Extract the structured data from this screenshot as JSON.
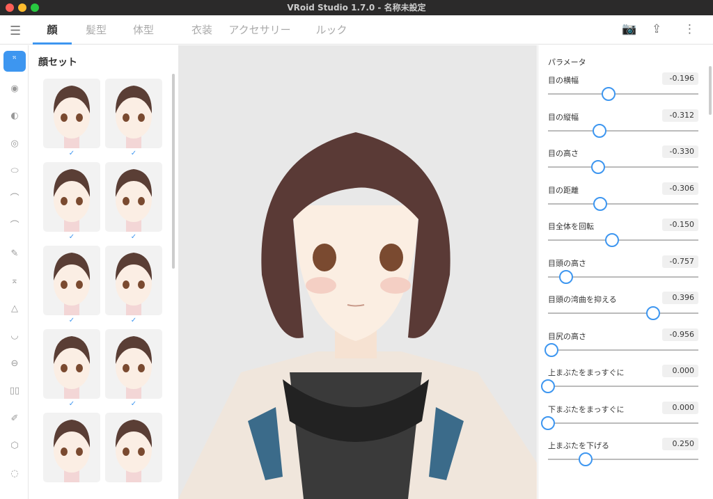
{
  "window": {
    "title": "VRoid Studio 1.7.0 - 名称未設定"
  },
  "tabs": [
    {
      "label": "顔",
      "active": true
    },
    {
      "label": "髪型"
    },
    {
      "label": "体型"
    },
    {
      "label": "衣装"
    },
    {
      "label": "アクセサリー"
    },
    {
      "label": "ルック"
    }
  ],
  "toolbar": {
    "icons": [
      "camera-icon",
      "share-icon",
      "more-icon"
    ]
  },
  "sidebar": {
    "icons": [
      "face-set-icon",
      "eye-icon",
      "iris-icon",
      "eye-highlight-icon",
      "eye-white-icon",
      "eyebrow-icon",
      "eyeline-icon",
      "eyelash-icon",
      "lower-eyelash-icon",
      "nose-icon",
      "mouth-icon",
      "teeth-icon",
      "face-line-icon",
      "brush-icon",
      "head-shape-icon",
      "ear-icon"
    ]
  },
  "face_sets": {
    "title": "顔セット",
    "count": 10
  },
  "params": {
    "title": "パラメータ",
    "range": [
      -1,
      1
    ],
    "items": [
      {
        "label": "目の横幅",
        "value": "-0.196"
      },
      {
        "label": "目の縦幅",
        "value": "-0.312"
      },
      {
        "label": "目の高さ",
        "value": "-0.330"
      },
      {
        "label": "目の距離",
        "value": "-0.306"
      },
      {
        "label": "目全体を回転",
        "value": "-0.150"
      },
      {
        "label": "目頭の高さ",
        "value": "-0.757"
      },
      {
        "label": "目頭の湾曲を抑える",
        "value": "0.396"
      },
      {
        "label": "目尻の高さ",
        "value": "-0.956"
      },
      {
        "label": "上まぶたをまっすぐに",
        "value": "0.000",
        "min": 0
      },
      {
        "label": "下まぶたをまっすぐに",
        "value": "0.000",
        "min": 0
      },
      {
        "label": "上まぶたを下げる",
        "value": "0.250",
        "min": 0
      }
    ]
  },
  "colors": {
    "accent": "#3d96f0"
  }
}
